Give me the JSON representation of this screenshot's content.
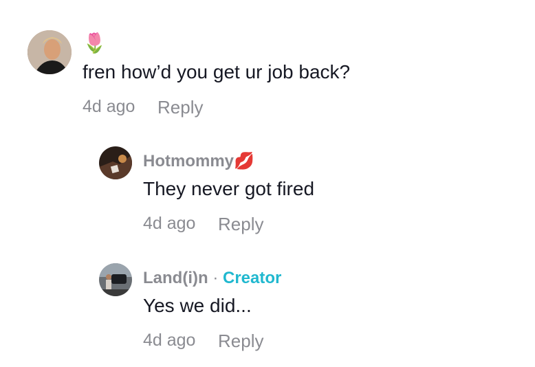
{
  "comments": [
    {
      "username_emoji": "🌷",
      "text": "fren how’d you get ur job back?",
      "time": "4d ago",
      "reply_label": "Reply"
    },
    {
      "username": "Hotmommy",
      "username_emoji": "💋",
      "text": "They never got fired",
      "time": "4d ago",
      "reply_label": "Reply"
    },
    {
      "username": "Land(i)n",
      "separator": "·",
      "creator_label": "Creator",
      "text": "Yes we did...",
      "time": "4d ago",
      "reply_label": "Reply"
    }
  ],
  "colors": {
    "primary_text": "#161823",
    "secondary_text": "#8a8b91",
    "creator_accent": "#20b8cf"
  }
}
